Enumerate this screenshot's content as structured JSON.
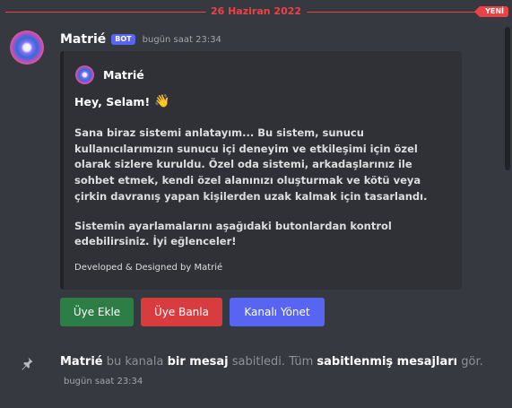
{
  "divider": {
    "date": "26 Haziran 2022",
    "new_label": "YENİ"
  },
  "message": {
    "username": "Matrié",
    "badge": "BOT",
    "timestamp": "bugün saat 23:34",
    "embed": {
      "author": "Matrié",
      "title": "Hey, Selam!",
      "title_emoji": "👋",
      "paragraphs": [
        "Sana biraz sistemi anlatayım... Bu sistem, sunucu kullanıcılarımızın sunucu içi deneyim ve etkileşimi için özel olarak sizlere kuruldu. Özel oda sistemi, arkadaşlarınız ile sohbet etmek, kendi özel alanınızı oluşturmak ve kötü veya çirkin davranış yapan kişilerden uzak kalmak için tasarlandı.",
        "Sistemin ayarlamalarını aşağıdaki butonlardan kontrol edebilirsiniz. İyi eğlenceler!"
      ],
      "footer": "Developed & Designed by Matrié"
    },
    "buttons": [
      {
        "label": "Üye Ekle",
        "color": "#2d7d46"
      },
      {
        "label": "Üye Banla",
        "color": "#d83c3e"
      },
      {
        "label": "Kanalı Yönet",
        "color": "#5865f2"
      }
    ]
  },
  "system_message": {
    "user": "Matrié",
    "text1": "bu kanala",
    "link1": "bir mesaj",
    "text2": "sabitledi. Tüm",
    "link2": "sabitlenmiş mesajları",
    "text3": "gör.",
    "timestamp": "bugün saat 23:34",
    "icon": "pin-icon"
  },
  "colors": {
    "background": "#36393f",
    "embed_bg": "#2f3136",
    "accent_red": "#ed4245",
    "blurple": "#5865f2"
  }
}
